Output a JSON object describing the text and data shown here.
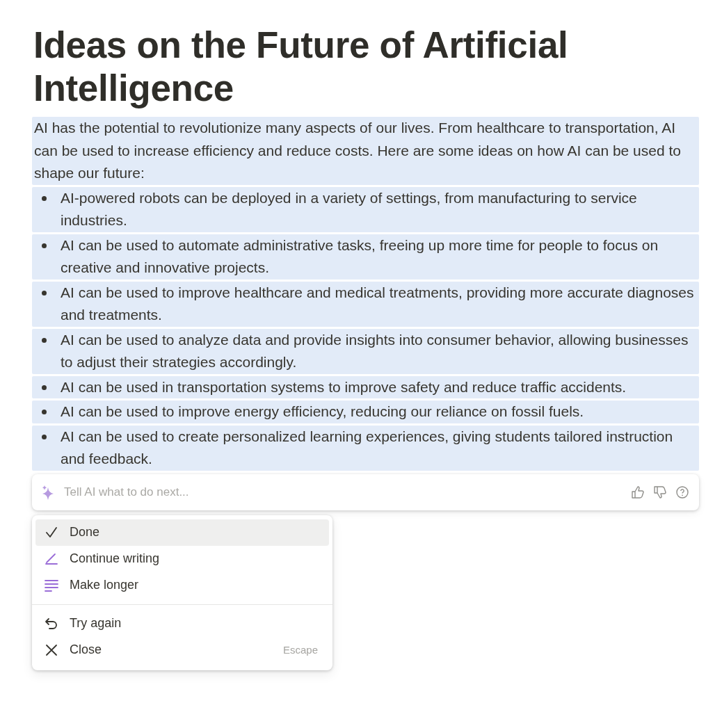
{
  "title": "Ideas on the Future of Artificial Intelligence",
  "intro": "AI has the potential to revolutionize many aspects of our lives. From healthcare to transportation, AI can be used to increase efficiency and reduce costs. Here are some ideas on how AI can be used to shape our future:",
  "bullets": [
    "AI-powered robots can be deployed in a variety of settings, from manufacturing to service industries.",
    "AI can be used to automate administrative tasks, freeing up more time for people to focus on creative and innovative projects.",
    "AI can be used to improve healthcare and medical treatments, providing more accurate diagnoses and treatments.",
    "AI can be used to analyze data and provide insights into consumer behavior, allowing businesses to adjust their strategies accordingly.",
    "AI can be used in transportation systems to improve safety and reduce traffic accidents.",
    "AI can be used to improve energy efficiency, reducing our reliance on fossil fuels.",
    "AI can be used to create personalized learning experiences, giving students tailored instruction and feedback."
  ],
  "prompt": {
    "placeholder": "Tell AI what to do next..."
  },
  "menu": [
    [
      {
        "kind": "check",
        "label": "Done",
        "selected": true
      },
      {
        "kind": "pen",
        "label": "Continue writing",
        "selected": false
      },
      {
        "kind": "lines",
        "label": "Make longer",
        "selected": false
      }
    ],
    [
      {
        "kind": "undo",
        "label": "Try again",
        "selected": false
      },
      {
        "kind": "close",
        "label": "Close",
        "shortcut": "Escape",
        "selected": false
      }
    ]
  ]
}
